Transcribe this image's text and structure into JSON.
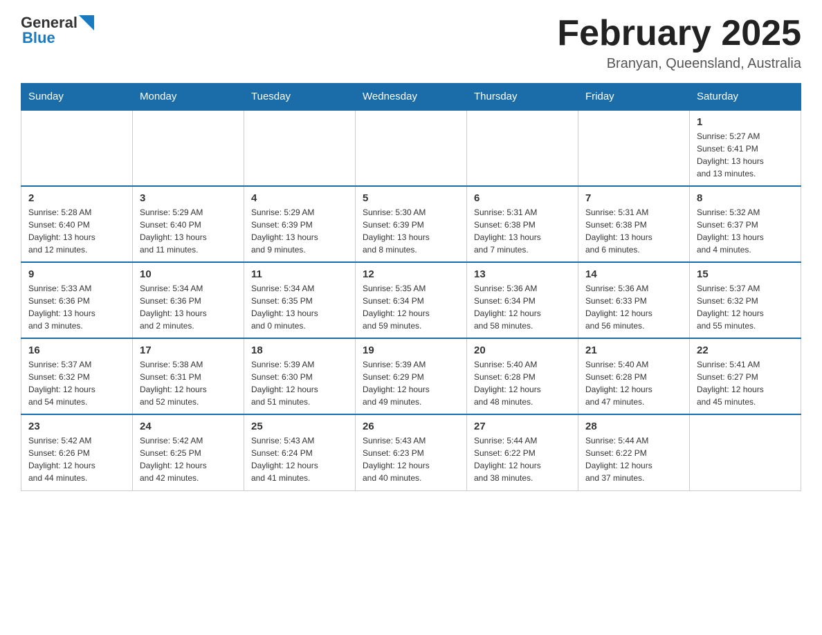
{
  "header": {
    "logo_general": "General",
    "logo_blue": "Blue",
    "title": "February 2025",
    "subtitle": "Branyan, Queensland, Australia"
  },
  "days_of_week": [
    "Sunday",
    "Monday",
    "Tuesday",
    "Wednesday",
    "Thursday",
    "Friday",
    "Saturday"
  ],
  "weeks": [
    {
      "days": [
        {
          "num": "",
          "info": ""
        },
        {
          "num": "",
          "info": ""
        },
        {
          "num": "",
          "info": ""
        },
        {
          "num": "",
          "info": ""
        },
        {
          "num": "",
          "info": ""
        },
        {
          "num": "",
          "info": ""
        },
        {
          "num": "1",
          "info": "Sunrise: 5:27 AM\nSunset: 6:41 PM\nDaylight: 13 hours\nand 13 minutes."
        }
      ]
    },
    {
      "days": [
        {
          "num": "2",
          "info": "Sunrise: 5:28 AM\nSunset: 6:40 PM\nDaylight: 13 hours\nand 12 minutes."
        },
        {
          "num": "3",
          "info": "Sunrise: 5:29 AM\nSunset: 6:40 PM\nDaylight: 13 hours\nand 11 minutes."
        },
        {
          "num": "4",
          "info": "Sunrise: 5:29 AM\nSunset: 6:39 PM\nDaylight: 13 hours\nand 9 minutes."
        },
        {
          "num": "5",
          "info": "Sunrise: 5:30 AM\nSunset: 6:39 PM\nDaylight: 13 hours\nand 8 minutes."
        },
        {
          "num": "6",
          "info": "Sunrise: 5:31 AM\nSunset: 6:38 PM\nDaylight: 13 hours\nand 7 minutes."
        },
        {
          "num": "7",
          "info": "Sunrise: 5:31 AM\nSunset: 6:38 PM\nDaylight: 13 hours\nand 6 minutes."
        },
        {
          "num": "8",
          "info": "Sunrise: 5:32 AM\nSunset: 6:37 PM\nDaylight: 13 hours\nand 4 minutes."
        }
      ]
    },
    {
      "days": [
        {
          "num": "9",
          "info": "Sunrise: 5:33 AM\nSunset: 6:36 PM\nDaylight: 13 hours\nand 3 minutes."
        },
        {
          "num": "10",
          "info": "Sunrise: 5:34 AM\nSunset: 6:36 PM\nDaylight: 13 hours\nand 2 minutes."
        },
        {
          "num": "11",
          "info": "Sunrise: 5:34 AM\nSunset: 6:35 PM\nDaylight: 13 hours\nand 0 minutes."
        },
        {
          "num": "12",
          "info": "Sunrise: 5:35 AM\nSunset: 6:34 PM\nDaylight: 12 hours\nand 59 minutes."
        },
        {
          "num": "13",
          "info": "Sunrise: 5:36 AM\nSunset: 6:34 PM\nDaylight: 12 hours\nand 58 minutes."
        },
        {
          "num": "14",
          "info": "Sunrise: 5:36 AM\nSunset: 6:33 PM\nDaylight: 12 hours\nand 56 minutes."
        },
        {
          "num": "15",
          "info": "Sunrise: 5:37 AM\nSunset: 6:32 PM\nDaylight: 12 hours\nand 55 minutes."
        }
      ]
    },
    {
      "days": [
        {
          "num": "16",
          "info": "Sunrise: 5:37 AM\nSunset: 6:32 PM\nDaylight: 12 hours\nand 54 minutes."
        },
        {
          "num": "17",
          "info": "Sunrise: 5:38 AM\nSunset: 6:31 PM\nDaylight: 12 hours\nand 52 minutes."
        },
        {
          "num": "18",
          "info": "Sunrise: 5:39 AM\nSunset: 6:30 PM\nDaylight: 12 hours\nand 51 minutes."
        },
        {
          "num": "19",
          "info": "Sunrise: 5:39 AM\nSunset: 6:29 PM\nDaylight: 12 hours\nand 49 minutes."
        },
        {
          "num": "20",
          "info": "Sunrise: 5:40 AM\nSunset: 6:28 PM\nDaylight: 12 hours\nand 48 minutes."
        },
        {
          "num": "21",
          "info": "Sunrise: 5:40 AM\nSunset: 6:28 PM\nDaylight: 12 hours\nand 47 minutes."
        },
        {
          "num": "22",
          "info": "Sunrise: 5:41 AM\nSunset: 6:27 PM\nDaylight: 12 hours\nand 45 minutes."
        }
      ]
    },
    {
      "days": [
        {
          "num": "23",
          "info": "Sunrise: 5:42 AM\nSunset: 6:26 PM\nDaylight: 12 hours\nand 44 minutes."
        },
        {
          "num": "24",
          "info": "Sunrise: 5:42 AM\nSunset: 6:25 PM\nDaylight: 12 hours\nand 42 minutes."
        },
        {
          "num": "25",
          "info": "Sunrise: 5:43 AM\nSunset: 6:24 PM\nDaylight: 12 hours\nand 41 minutes."
        },
        {
          "num": "26",
          "info": "Sunrise: 5:43 AM\nSunset: 6:23 PM\nDaylight: 12 hours\nand 40 minutes."
        },
        {
          "num": "27",
          "info": "Sunrise: 5:44 AM\nSunset: 6:22 PM\nDaylight: 12 hours\nand 38 minutes."
        },
        {
          "num": "28",
          "info": "Sunrise: 5:44 AM\nSunset: 6:22 PM\nDaylight: 12 hours\nand 37 minutes."
        },
        {
          "num": "",
          "info": ""
        }
      ]
    }
  ]
}
